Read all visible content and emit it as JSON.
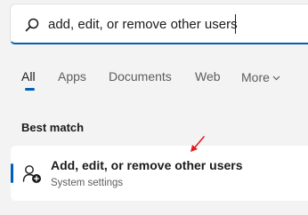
{
  "search": {
    "icon": "search-icon",
    "value": "add, edit, or remove other users",
    "accent_color": "#005fb8"
  },
  "tabs": [
    {
      "label": "All",
      "active": true
    },
    {
      "label": "Apps",
      "active": false
    },
    {
      "label": "Documents",
      "active": false
    },
    {
      "label": "Web",
      "active": false
    },
    {
      "label": "More",
      "active": false,
      "icon": "chevron-down-icon"
    }
  ],
  "best_match": {
    "heading": "Best match",
    "result": {
      "title": "Add, edit, or remove other users",
      "subtitle": "System settings",
      "icon": "user-add-icon"
    }
  },
  "annotation": {
    "icon": "red-arrow-icon",
    "color": "#e01e1e"
  }
}
